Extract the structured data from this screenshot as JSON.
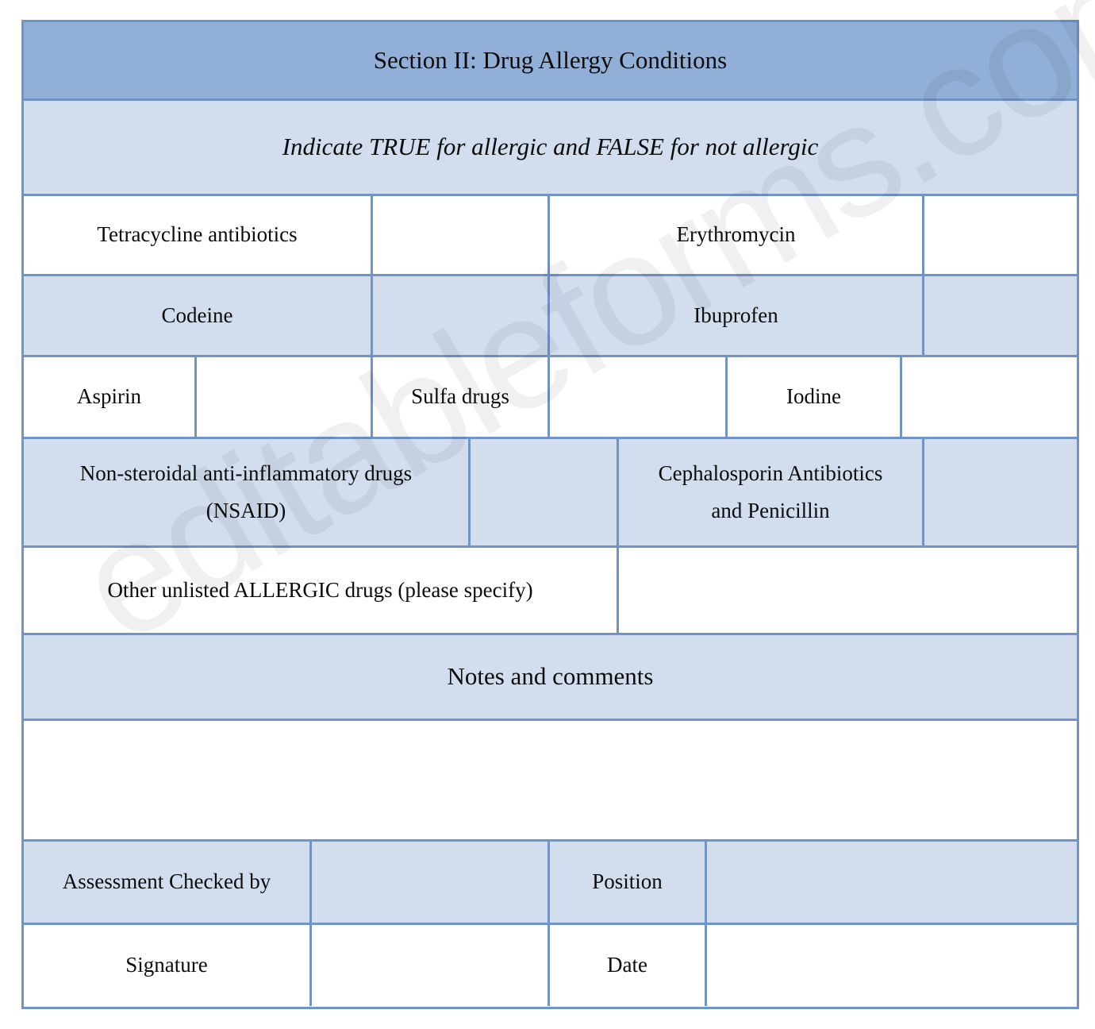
{
  "watermark": {
    "text": "editableforms.com"
  },
  "colors": {
    "header_band": "#92b0d7",
    "light_band": "#d2deee",
    "border": "#7194c4",
    "white": "#ffffff",
    "text": "#0c0c0c"
  },
  "form": {
    "title": "Section II: Drug Allergy Conditions",
    "instruction": "Indicate TRUE for allergic and FALSE for not allergic",
    "drug_rows": [
      {
        "shade": "white",
        "left_label": "Tetracycline antibiotics",
        "left_value": "",
        "right_label": "Erythromycin",
        "right_value": ""
      },
      {
        "shade": "light",
        "left_label": "Codeine",
        "left_value": "",
        "right_label": "Ibuprofen",
        "right_value": ""
      }
    ],
    "triple_row": {
      "shade": "white",
      "item1_label": "Aspirin",
      "item1_value": "",
      "item2_label": "Sulfa drugs",
      "item2_value": "",
      "item3_label": "Iodine",
      "item3_value": ""
    },
    "nsaid_row": {
      "shade": "light",
      "left_label_line1": "Non-steroidal anti-inflammatory drugs",
      "left_label_line2": "(NSAID)",
      "left_value": "",
      "right_label_line1": "Cephalosporin Antibiotics",
      "right_label_line2": "and Penicillin",
      "right_value": ""
    },
    "other_row": {
      "shade": "white",
      "label": "Other unlisted ALLERGIC drugs (please specify)",
      "value": ""
    },
    "notes": {
      "header": "Notes and comments",
      "body_value": ""
    },
    "signoff_rows": [
      {
        "shade": "light",
        "label1": "Assessment Checked by",
        "value1": "",
        "label2": "Position",
        "value2": ""
      },
      {
        "shade": "white",
        "label1": "Signature",
        "value1": "",
        "label2": "Date",
        "value2": ""
      }
    ]
  }
}
